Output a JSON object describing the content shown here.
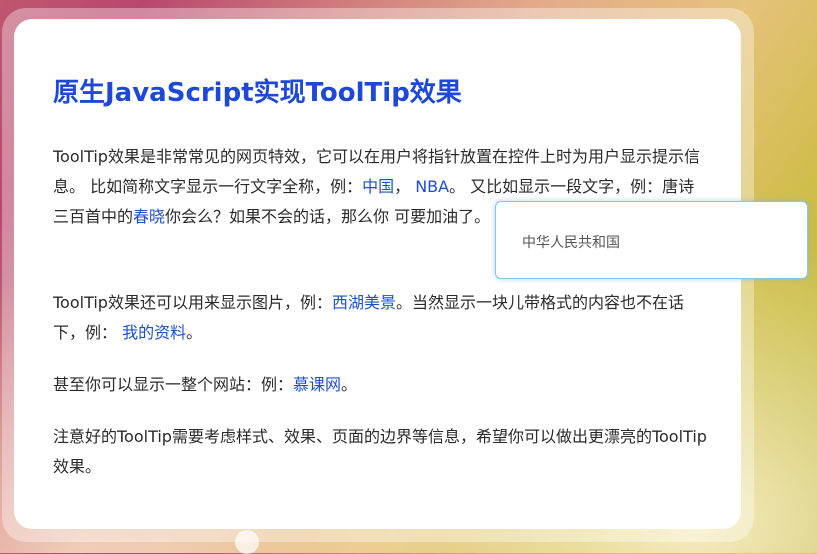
{
  "title": "原生JavaScript实现ToolTip效果",
  "paragraph1": {
    "t1": "ToolTip效果是非常常见的网页特效，它可以在用户将指针放置在控件上时为用户显示提示信息。 比如简称文字显示一行文字全称，例：",
    "link_china": "中国",
    "t2": "， ",
    "link_nba": "NBA",
    "t3": "。 又比如显示一段文字，例：唐诗三百首中的",
    "link_chunxiao": "春晓",
    "t4": "你会么？如果不会的话，那么你 可要加油了。"
  },
  "paragraph2": {
    "t1": "ToolTip效果还可以用来显示图片，例：",
    "link_xihu": "西湖美景",
    "t2": "。当然显示一块儿带格式的内容也不在话下，例： ",
    "link_ziliao": "我的资料",
    "t3": "。"
  },
  "paragraph3": {
    "t1": "甚至你可以显示一整个网站：例：",
    "link_mooc": "慕课网",
    "t2": "。"
  },
  "paragraph4": {
    "t1": "注意好的ToolTip需要考虑样式、效果、页面的边界等信息，希望你可以做出更漂亮的ToolTip效果。"
  },
  "tooltip": {
    "text": "中华人民共和国"
  },
  "colors": {
    "title": "#1e49d8",
    "link": "#1c4fd1",
    "tooltip_border": "#89c6e6"
  }
}
